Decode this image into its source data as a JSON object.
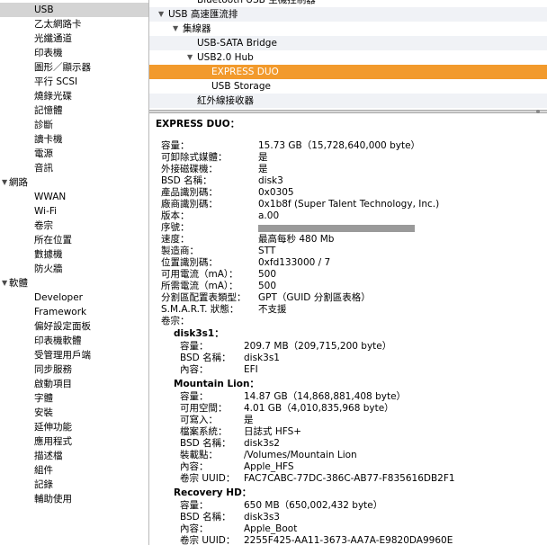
{
  "sidebar": {
    "items": [
      {
        "label": "USB",
        "level": 1,
        "selected": true
      },
      {
        "label": "乙太網路卡",
        "level": 1
      },
      {
        "label": "光纖通道",
        "level": 1
      },
      {
        "label": "印表機",
        "level": 1
      },
      {
        "label": "圖形／顯示器",
        "level": 1
      },
      {
        "label": "平行 SCSI",
        "level": 1
      },
      {
        "label": "燒錄光碟",
        "level": 1
      },
      {
        "label": "記憶體",
        "level": 1
      },
      {
        "label": "診斷",
        "level": 1
      },
      {
        "label": "讀卡機",
        "level": 1
      },
      {
        "label": "電源",
        "level": 1
      },
      {
        "label": "音訊",
        "level": 1
      },
      {
        "label": "網路",
        "level": 0,
        "group": true
      },
      {
        "label": "WWAN",
        "level": 1
      },
      {
        "label": "Wi-Fi",
        "level": 1
      },
      {
        "label": "卷宗",
        "level": 1
      },
      {
        "label": "所在位置",
        "level": 1
      },
      {
        "label": "數據機",
        "level": 1
      },
      {
        "label": "防火牆",
        "level": 1
      },
      {
        "label": "軟體",
        "level": 0,
        "group": true
      },
      {
        "label": "Developer",
        "level": 1
      },
      {
        "label": "Framework",
        "level": 1
      },
      {
        "label": "偏好設定面板",
        "level": 1
      },
      {
        "label": "印表機軟體",
        "level": 1
      },
      {
        "label": "受管理用戶端",
        "level": 1
      },
      {
        "label": "同步服務",
        "level": 1
      },
      {
        "label": "啟動項目",
        "level": 1
      },
      {
        "label": "字體",
        "level": 1
      },
      {
        "label": "安裝",
        "level": 1
      },
      {
        "label": "延伸功能",
        "level": 1
      },
      {
        "label": "應用程式",
        "level": 1
      },
      {
        "label": "描述檔",
        "level": 1
      },
      {
        "label": "組件",
        "level": 1
      },
      {
        "label": "記錄",
        "level": 1
      },
      {
        "label": "輔助使用",
        "level": 1
      }
    ]
  },
  "tree": {
    "rows": [
      {
        "label": "Bluetooth USB 主機控制器",
        "indent": 2,
        "tri": false
      },
      {
        "label": "USB 高速匯流排",
        "indent": 0,
        "tri": true
      },
      {
        "label": "集線器",
        "indent": 1,
        "tri": true
      },
      {
        "label": "USB-SATA Bridge",
        "indent": 2,
        "tri": false
      },
      {
        "label": "USB2.0 Hub",
        "indent": 2,
        "tri": true
      },
      {
        "label": "EXPRESS DUO",
        "indent": 3,
        "tri": false,
        "selected": true
      },
      {
        "label": "USB Storage",
        "indent": 3,
        "tri": false
      },
      {
        "label": "紅外線接收器",
        "indent": 2,
        "tri": false
      }
    ]
  },
  "detail": {
    "title": "EXPRESS DUO：",
    "properties": [
      {
        "k": "容量：",
        "v": "15.73 GB（15,728,640,000 byte）"
      },
      {
        "k": "可卸除式媒體：",
        "v": "是"
      },
      {
        "k": "外接磁碟機：",
        "v": "是"
      },
      {
        "k": "BSD 名稱：",
        "v": "disk3"
      },
      {
        "k": "產品識別碼：",
        "v": "0x0305"
      },
      {
        "k": "廠商識別碼：",
        "v": "0x1b8f  (Super Talent Technology, Inc.)"
      },
      {
        "k": "版本：",
        "v": " a.00"
      },
      {
        "k": "序號：",
        "v": "",
        "redacted": true
      },
      {
        "k": "速度：",
        "v": "最高每秒 480 Mb"
      },
      {
        "k": "製造商：",
        "v": "STT"
      },
      {
        "k": "位置識別碼：",
        "v": "0xfd133000 / 7"
      },
      {
        "k": "可用電流（mA）：",
        "v": "500"
      },
      {
        "k": "所需電流（mA）：",
        "v": "500"
      },
      {
        "k": "分割區配置表類型：",
        "v": "GPT（GUID 分割區表格）"
      },
      {
        "k": "S.M.A.R.T. 狀態：",
        "v": "不支援"
      }
    ],
    "volumes_label": "卷宗：",
    "volumes": [
      {
        "name": "disk3s1：",
        "props": [
          {
            "k": "容量：",
            "v": "209.7 MB（209,715,200 byte）"
          },
          {
            "k": "BSD 名稱：",
            "v": "disk3s1"
          },
          {
            "k": "內容：",
            "v": "EFI"
          }
        ]
      },
      {
        "name": "Mountain Lion：",
        "props": [
          {
            "k": "容量：",
            "v": "14.87 GB（14,868,881,408 byte）"
          },
          {
            "k": "可用空間：",
            "v": "4.01 GB（4,010,835,968 byte）"
          },
          {
            "k": "可寫入：",
            "v": "是"
          },
          {
            "k": "檔案系統：",
            "v": "日誌式 HFS+"
          },
          {
            "k": "BSD 名稱：",
            "v": "disk3s2"
          },
          {
            "k": "裝載點：",
            "v": "/Volumes/Mountain Lion"
          },
          {
            "k": "內容：",
            "v": "Apple_HFS"
          },
          {
            "k": "卷宗 UUID：",
            "v": "FAC7CABC-77DC-386C-AB77-F835616DB2F1"
          }
        ]
      },
      {
        "name": "Recovery HD：",
        "props": [
          {
            "k": "容量：",
            "v": "650 MB（650,002,432 byte）"
          },
          {
            "k": "BSD 名稱：",
            "v": "disk3s3"
          },
          {
            "k": "內容：",
            "v": "Apple_Boot"
          },
          {
            "k": "卷宗 UUID：",
            "v": "2255F425-AA11-3673-AA7A-E9820DA9960E"
          }
        ]
      }
    ]
  },
  "colors": {
    "selection": "#f29a2c",
    "sidebar_selection": "#d4d4d4"
  }
}
